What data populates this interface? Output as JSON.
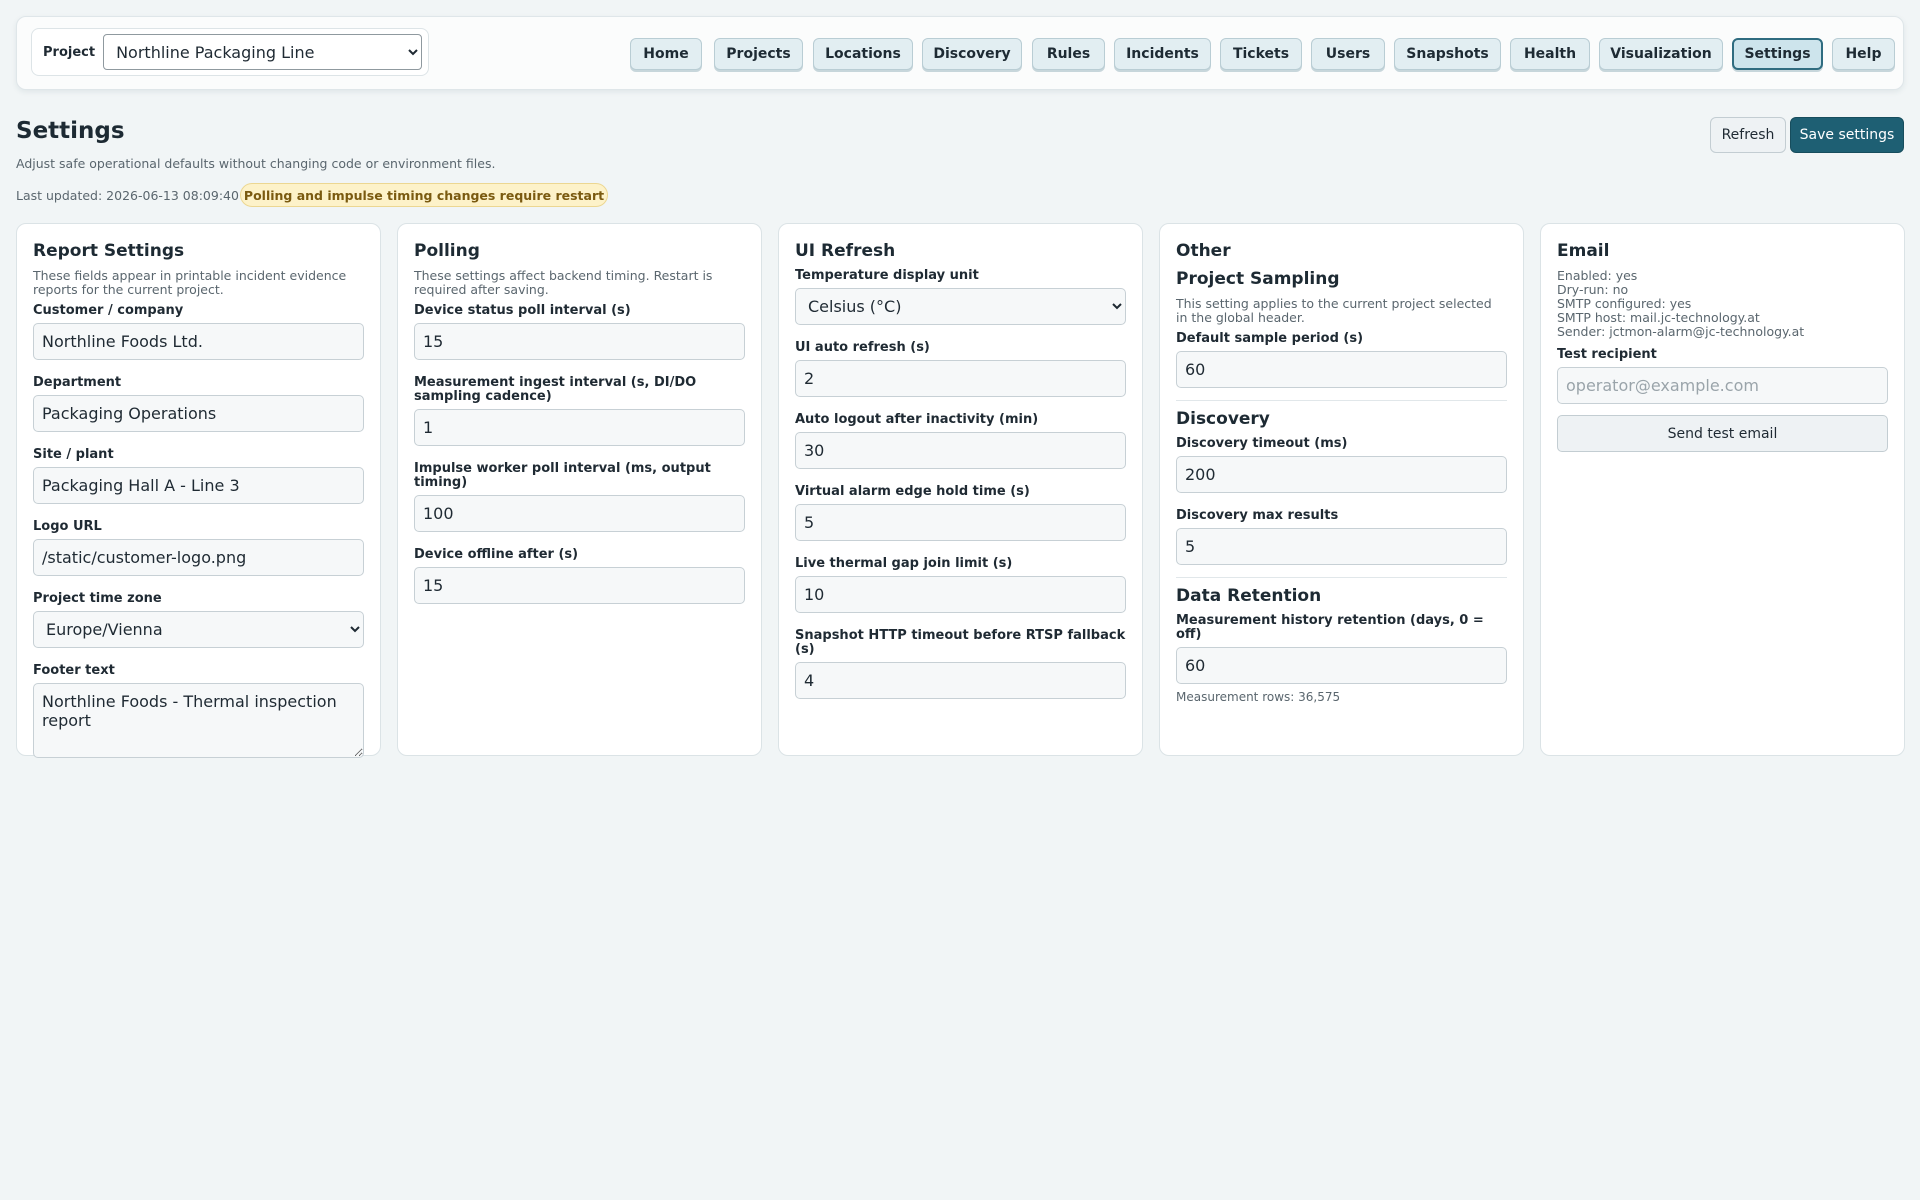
{
  "header": {
    "project_label": "Project",
    "project_selected": "Northline Packaging Line",
    "nav": [
      {
        "label": "Home"
      },
      {
        "label": "Projects"
      },
      {
        "label": "Locations"
      },
      {
        "label": "Discovery"
      },
      {
        "label": "Rules"
      },
      {
        "label": "Incidents"
      },
      {
        "label": "Tickets"
      },
      {
        "label": "Users"
      },
      {
        "label": "Snapshots"
      },
      {
        "label": "Health"
      },
      {
        "label": "Visualization"
      },
      {
        "label": "Settings",
        "active": true
      },
      {
        "label": "Help"
      }
    ]
  },
  "page": {
    "title": "Settings",
    "subtitle": "Adjust safe operational defaults without changing code or environment files.",
    "last_updated": "Last updated: 2026-06-13 08:09:40",
    "restart_badge": "Polling and impulse timing changes require restart",
    "refresh_label": "Refresh",
    "save_label": "Save settings"
  },
  "report": {
    "title": "Report Settings",
    "description": "These fields appear in printable incident evidence reports for the current project.",
    "customer_label": "Customer / company",
    "customer_value": "Northline Foods Ltd.",
    "department_label": "Department",
    "department_value": "Packaging Operations",
    "site_label": "Site / plant",
    "site_value": "Packaging Hall A - Line 3",
    "logo_label": "Logo URL",
    "logo_value": "/static/customer-logo.png",
    "timezone_label": "Project time zone",
    "timezone_value": "Europe/Vienna",
    "footer_label": "Footer text",
    "footer_value": "Northline Foods - Thermal inspection report"
  },
  "polling": {
    "title": "Polling",
    "description": "These settings affect backend timing. Restart is required after saving.",
    "status_poll_label": "Device status poll interval (s)",
    "status_poll_value": "15",
    "ingest_label": "Measurement ingest interval (s, DI/DO sampling cadence)",
    "ingest_value": "1",
    "impulse_label": "Impulse worker poll interval (ms, output timing)",
    "impulse_value": "100",
    "offline_label": "Device offline after (s)",
    "offline_value": "15"
  },
  "ui_refresh": {
    "title": "UI Refresh",
    "temp_unit_label": "Temperature display unit",
    "temp_unit_value": "Celsius (°C)",
    "auto_refresh_label": "UI auto refresh (s)",
    "auto_refresh_value": "2",
    "logout_label": "Auto logout after inactivity (min)",
    "logout_value": "30",
    "edge_hold_label": "Virtual alarm edge hold time (s)",
    "edge_hold_value": "5",
    "gap_join_label": "Live thermal gap join limit (s)",
    "gap_join_value": "10",
    "snapshot_timeout_label": "Snapshot HTTP timeout before RTSP fallback (s)",
    "snapshot_timeout_value": "4"
  },
  "other": {
    "title": "Other",
    "sampling_title": "Project Sampling",
    "sampling_description": "This setting applies to the current project selected in the global header.",
    "sample_period_label": "Default sample period (s)",
    "sample_period_value": "60",
    "discovery_title": "Discovery",
    "discovery_timeout_label": "Discovery timeout (ms)",
    "discovery_timeout_value": "200",
    "discovery_max_label": "Discovery max results",
    "discovery_max_value": "5",
    "retention_title": "Data Retention",
    "retention_label": "Measurement history retention (days, 0 = off)",
    "retention_value": "60",
    "rows_note": "Measurement rows: 36,575"
  },
  "email": {
    "title": "Email",
    "enabled": "Enabled: yes",
    "dry_run": "Dry-run: no",
    "smtp_configured": "SMTP configured: yes",
    "smtp_host": "SMTP host: mail.jc-technology.at",
    "sender": "Sender: jctmon-alarm@jc-technology.at",
    "recipient_label": "Test recipient",
    "recipient_placeholder": "operator@example.com",
    "recipient_value": "",
    "send_label": "Send test email"
  }
}
